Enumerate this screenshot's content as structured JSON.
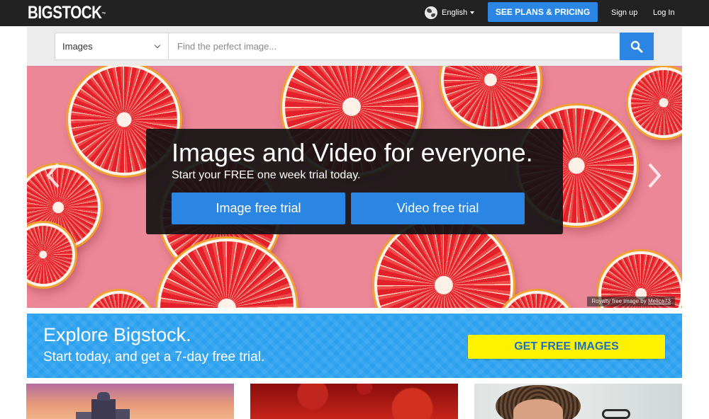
{
  "header": {
    "logo_text": "BIGSTOCK",
    "logo_tm": "™",
    "language_label": "English",
    "plans_button_label": "SEE PLANS & PRICING",
    "signup_label": "Sign up",
    "login_label": "Log In",
    "colors": {
      "bar": "#222222",
      "accent": "#2b86e3"
    }
  },
  "search": {
    "type_selected": "Images",
    "placeholder": "Find the perfect image...",
    "icon": "search-icon"
  },
  "hero": {
    "title": "Images and Video for everyone.",
    "subtitle": "Start your FREE one week trial today.",
    "image_trial_label": "Image free trial",
    "video_trial_label": "Video free trial",
    "credit_prefix": "Royalty free image by",
    "credit_author": "Melica73",
    "prev_icon": "chevron-left-icon",
    "next_icon": "chevron-right-icon",
    "background_color": "#ec8797"
  },
  "promo": {
    "title": "Explore Bigstock.",
    "subtitle": "Start today, and get a 7-day free trial.",
    "button_label": "GET FREE IMAGES",
    "background_color": "#2aa0ee",
    "button_color": "#fff200"
  },
  "thumbnails": [
    {
      "name": "city-skyline-sunset-thumbnail"
    },
    {
      "name": "red-virus-particles-thumbnail"
    },
    {
      "name": "curly-hair-portrait-thumbnail"
    }
  ]
}
